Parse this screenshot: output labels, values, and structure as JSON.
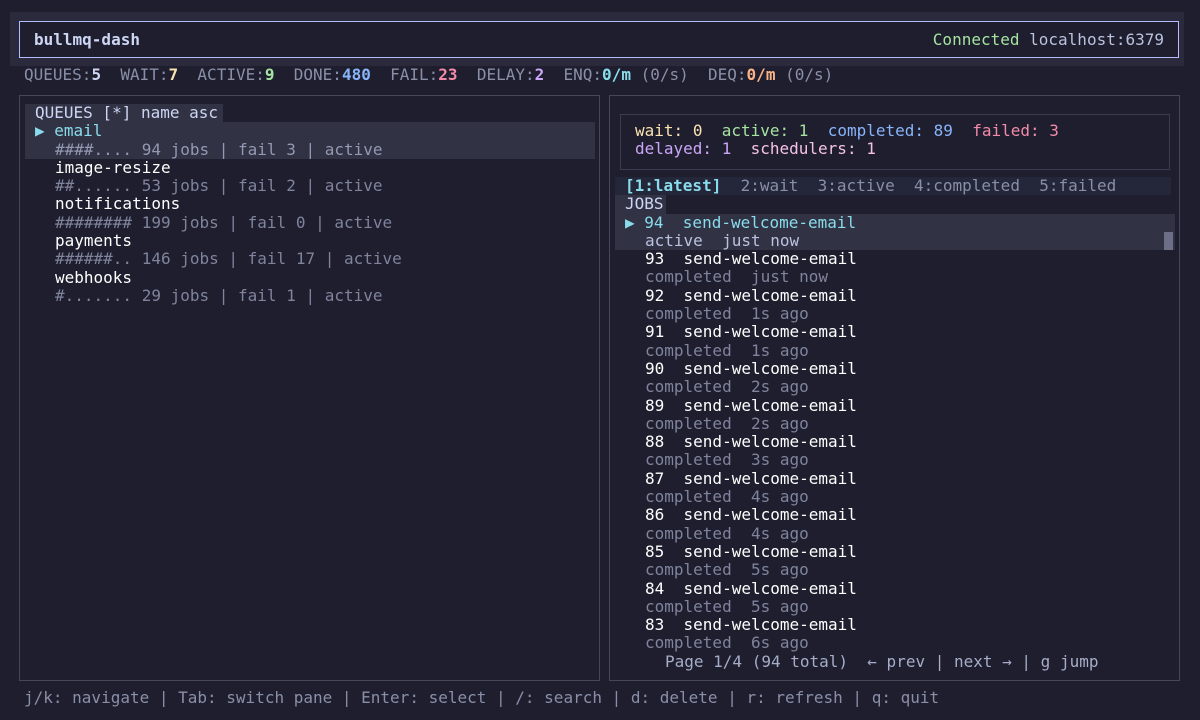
{
  "header": {
    "app_title": "bullmq-dash",
    "status": "Connected",
    "host": "localhost:6379"
  },
  "stats": [
    {
      "label": "QUEUES:",
      "value": "5",
      "extra": "",
      "color": "#cdd6f4"
    },
    {
      "label": "WAIT:",
      "value": "7",
      "extra": "",
      "color": "#f9e2af"
    },
    {
      "label": "ACTIVE:",
      "value": "9",
      "extra": "",
      "color": "#a6e3a1"
    },
    {
      "label": "DONE:",
      "value": "480",
      "extra": "",
      "color": "#89b4fa"
    },
    {
      "label": "FAIL:",
      "value": "23",
      "extra": "",
      "color": "#f38ba8"
    },
    {
      "label": "DELAY:",
      "value": "2",
      "extra": "",
      "color": "#cba6f7"
    },
    {
      "label": "ENQ:",
      "value": "0/m",
      "extra": " (0/s)",
      "color": "#89dceb"
    },
    {
      "label": "DEQ:",
      "value": "0/m",
      "extra": " (0/s)",
      "color": "#fab387"
    }
  ],
  "queues": {
    "header": "QUEUES [*] name asc",
    "selected_marker": "▶ ",
    "items": [
      {
        "name": "email",
        "meta": "####.... 94 jobs | fail 3 | active",
        "selected": true
      },
      {
        "name": "image-resize",
        "meta": "##...... 53 jobs | fail 2 | active",
        "selected": false
      },
      {
        "name": "notifications",
        "meta": "######## 199 jobs | fail 0 | active",
        "selected": false
      },
      {
        "name": "payments",
        "meta": "######.. 146 jobs | fail 17 | active",
        "selected": false
      },
      {
        "name": "webhooks",
        "meta": "#....... 29 jobs | fail 1 | active",
        "selected": false
      }
    ]
  },
  "counts": {
    "wait_label": "wait:",
    "wait": "0",
    "active_label": "active:",
    "active": "1",
    "completed_label": "completed:",
    "completed": "89",
    "failed_label": "failed:",
    "failed": "3",
    "delayed_label": "delayed:",
    "delayed": "1",
    "schedulers_label": "schedulers:",
    "schedulers": "1"
  },
  "tabs": [
    {
      "label": "[1:latest]",
      "active": true
    },
    {
      "label": "2:wait",
      "active": false
    },
    {
      "label": "3:active",
      "active": false
    },
    {
      "label": "4:completed",
      "active": false
    },
    {
      "label": "5:failed",
      "active": false
    }
  ],
  "jobs": {
    "header": "JOBS",
    "items": [
      {
        "id": "94",
        "name": "send-welcome-email",
        "state": "active",
        "time": "just now",
        "selected": true
      },
      {
        "id": "93",
        "name": "send-welcome-email",
        "state": "completed",
        "time": "just now",
        "selected": false
      },
      {
        "id": "92",
        "name": "send-welcome-email",
        "state": "completed",
        "time": "1s ago",
        "selected": false
      },
      {
        "id": "91",
        "name": "send-welcome-email",
        "state": "completed",
        "time": "1s ago",
        "selected": false
      },
      {
        "id": "90",
        "name": "send-welcome-email",
        "state": "completed",
        "time": "2s ago",
        "selected": false
      },
      {
        "id": "89",
        "name": "send-welcome-email",
        "state": "completed",
        "time": "2s ago",
        "selected": false
      },
      {
        "id": "88",
        "name": "send-welcome-email",
        "state": "completed",
        "time": "3s ago",
        "selected": false
      },
      {
        "id": "87",
        "name": "send-welcome-email",
        "state": "completed",
        "time": "4s ago",
        "selected": false
      },
      {
        "id": "86",
        "name": "send-welcome-email",
        "state": "completed",
        "time": "4s ago",
        "selected": false
      },
      {
        "id": "85",
        "name": "send-welcome-email",
        "state": "completed",
        "time": "5s ago",
        "selected": false
      },
      {
        "id": "84",
        "name": "send-welcome-email",
        "state": "completed",
        "time": "5s ago",
        "selected": false
      },
      {
        "id": "83",
        "name": "send-welcome-email",
        "state": "completed",
        "time": "6s ago",
        "selected": false
      }
    ]
  },
  "pager": "Page 1/4 (94 total)  ← prev | next → | g jump",
  "footer": "j/k: navigate | Tab: switch pane | Enter: select | /: search | d: delete | r: refresh | q: quit"
}
